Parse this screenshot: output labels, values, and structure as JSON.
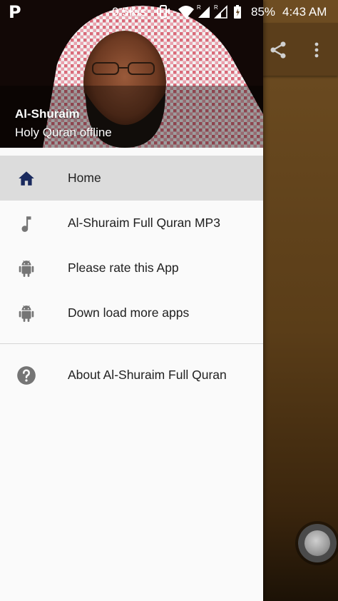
{
  "status_bar": {
    "app_glyph": "P",
    "network_speed": "0.5K/s",
    "battery_percent": "85%",
    "time": "4:43 AM",
    "icons": [
      "vibrate-icon",
      "wifi-icon",
      "signal-icon",
      "signal-icon",
      "battery-icon"
    ]
  },
  "drawer": {
    "header": {
      "title": "Al-Shuraim",
      "subtitle": "Holy Quran offline"
    },
    "items": [
      {
        "label": "Home",
        "icon": "home-icon",
        "active": true
      },
      {
        "label": "Al-Shuraim Full Quran MP3",
        "icon": "music-note-icon",
        "active": false
      },
      {
        "label": "Please rate this App",
        "icon": "android-icon",
        "active": false
      },
      {
        "label": "Down load more apps",
        "icon": "android-icon",
        "active": false
      }
    ],
    "about": {
      "label": "About Al-Shuraim Full Quran",
      "icon": "help-icon"
    }
  },
  "background_app": {
    "toolbar_icons": [
      "share-icon",
      "more-vert-icon"
    ]
  },
  "colors": {
    "active_item_bg": "#dcdcdc",
    "home_icon": "#1a2a5e",
    "icon_gray": "#757575",
    "background_toolbar": "#5b3e1b"
  }
}
